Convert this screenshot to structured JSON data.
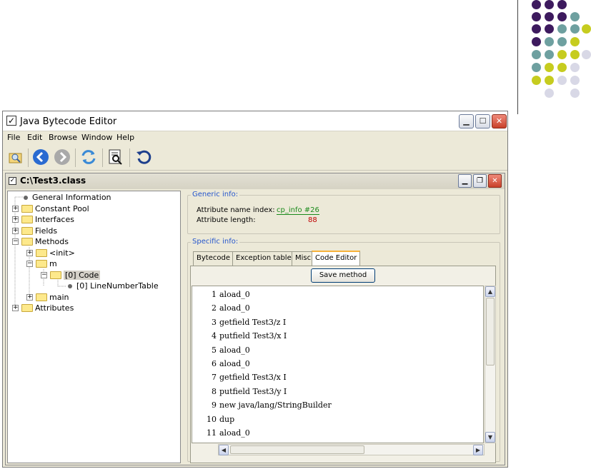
{
  "app": {
    "title": "Java Bytecode Editor"
  },
  "menu": [
    "File",
    "Edit",
    "Browse",
    "Window",
    "Help"
  ],
  "toolbar": {
    "icons": [
      "open-icon",
      "back-icon",
      "forward-icon",
      "refresh-icon",
      "inspect-icon",
      "reload-icon"
    ]
  },
  "inner_window": {
    "title": "C:\\Test3.class"
  },
  "tree": {
    "general": "General Information",
    "constant_pool": "Constant Pool",
    "interfaces": "Interfaces",
    "fields": "Fields",
    "methods": "Methods",
    "init": "<init>",
    "m": "m",
    "code": "[0] Code",
    "line_number_table": "[0] LineNumberTable",
    "main": "main",
    "attributes": "Attributes"
  },
  "generic_info": {
    "label": "Generic info:",
    "name_index_label": "Attribute name index:",
    "name_index_value": "cp_info #26",
    "length_label": "Attribute length:",
    "length_value": "88"
  },
  "specific_info": {
    "label": "Specific info:",
    "tabs": [
      "Bytecode",
      "Exception table",
      "Misc",
      "Code Editor"
    ],
    "active_tab": "Code Editor",
    "save_label": "Save method"
  },
  "code_lines": [
    {
      "n": "1",
      "text": "aload_0"
    },
    {
      "n": "2",
      "text": "aload_0"
    },
    {
      "n": "3",
      "text": "getfield Test3/z I"
    },
    {
      "n": "4",
      "text": "putfield Test3/x I"
    },
    {
      "n": "5",
      "text": "aload_0"
    },
    {
      "n": "6",
      "text": "aload_0"
    },
    {
      "n": "7",
      "text": "getfield Test3/x I"
    },
    {
      "n": "8",
      "text": "putfield Test3/y I"
    },
    {
      "n": "9",
      "text": "new java/lang/StringBuilder"
    },
    {
      "n": "10",
      "text": "dup"
    },
    {
      "n": "11",
      "text": "aload_0"
    }
  ],
  "colors": {
    "link": "#1a8a1a",
    "value_red": "#c00000",
    "group_label": "#2656cc",
    "tab_highlight": "#f7b23b"
  }
}
